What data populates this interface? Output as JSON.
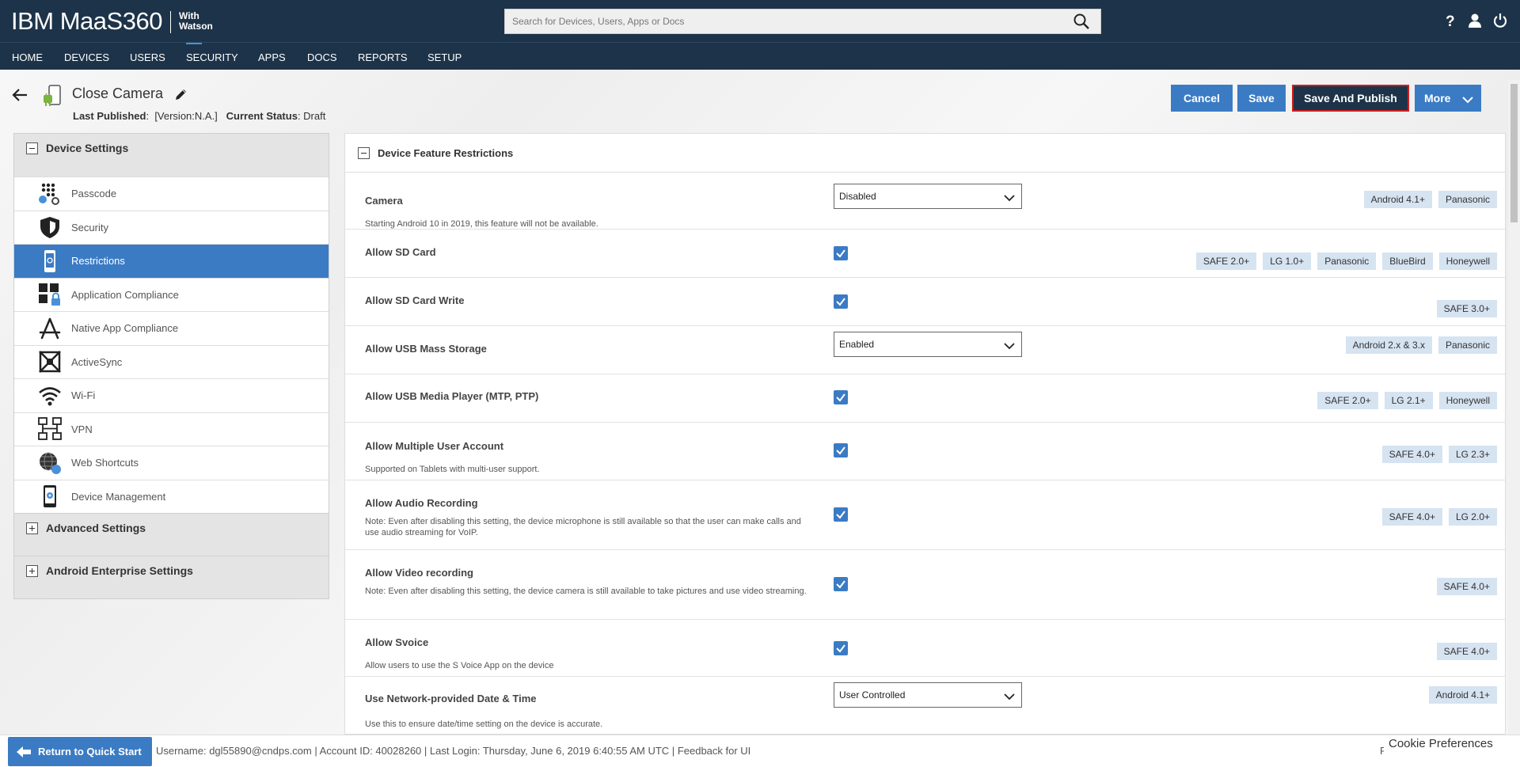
{
  "header": {
    "logo": "IBM MaaS360",
    "logo_with": "With",
    "logo_watson": "Watson",
    "search_placeholder": "Search for Devices, Users, Apps or Docs"
  },
  "nav": [
    "HOME",
    "DEVICES",
    "USERS",
    "SECURITY",
    "APPS",
    "DOCS",
    "REPORTS",
    "SETUP"
  ],
  "nav_active": "SECURITY",
  "page": {
    "title": "Close Camera",
    "last_published_label": "Last Published",
    "last_published_value": "[Version:N.A.]",
    "status_label": "Current Status",
    "status_value": "Draft"
  },
  "actions": {
    "cancel": "Cancel",
    "save": "Save",
    "publish": "Save And Publish",
    "more": "More"
  },
  "sidebar": {
    "group1": "Device Settings",
    "items": [
      {
        "label": "Passcode",
        "icon": "keypad-icon"
      },
      {
        "label": "Security",
        "icon": "shield-icon"
      },
      {
        "label": "Restrictions",
        "icon": "phone-restriction-icon"
      },
      {
        "label": "Application Compliance",
        "icon": "app-lock-icon"
      },
      {
        "label": "Native App Compliance",
        "icon": "app-store-icon"
      },
      {
        "label": "ActiveSync",
        "icon": "sync-icon"
      },
      {
        "label": "Wi-Fi",
        "icon": "wifi-icon"
      },
      {
        "label": "VPN",
        "icon": "network-icon"
      },
      {
        "label": "Web Shortcuts",
        "icon": "globe-icon"
      },
      {
        "label": "Device Management",
        "icon": "device-gear-icon"
      }
    ],
    "group2": "Advanced Settings",
    "group3": "Android Enterprise Settings"
  },
  "main": {
    "section_title": "Device Feature Restrictions",
    "rows": [
      {
        "label": "Camera",
        "control": "select",
        "value": "Disabled",
        "note": "Starting Android 10 in 2019, this feature will not be available.",
        "tags": [
          "Android 4.1+",
          "Panasonic"
        ]
      },
      {
        "label": "Allow SD Card",
        "control": "check",
        "checked": true,
        "note": "",
        "tags": [
          "SAFE 2.0+",
          "LG 1.0+",
          "Panasonic",
          "BlueBird",
          "Honeywell"
        ]
      },
      {
        "label": "Allow SD Card Write",
        "control": "check",
        "checked": true,
        "note": "",
        "tags": [
          "SAFE 3.0+"
        ]
      },
      {
        "label": "Allow USB Mass Storage",
        "control": "select",
        "value": "Enabled",
        "note": "",
        "tags": [
          "Android 2.x & 3.x",
          "Panasonic"
        ]
      },
      {
        "label": "Allow USB Media Player (MTP, PTP)",
        "control": "check",
        "checked": true,
        "note": "",
        "tags": [
          "SAFE 2.0+",
          "LG 2.1+",
          "Honeywell"
        ]
      },
      {
        "label": "Allow Multiple User Account",
        "control": "check",
        "checked": true,
        "note": "Supported on Tablets with multi-user support.",
        "tags": [
          "SAFE 4.0+",
          "LG 2.3+"
        ]
      },
      {
        "label": "Allow Audio Recording",
        "control": "check",
        "checked": true,
        "note": "Note: Even after disabling this setting, the device microphone is still available so that the user can make calls and use audio streaming for VoIP.",
        "tags": [
          "SAFE 4.0+",
          "LG 2.0+"
        ]
      },
      {
        "label": "Allow Video recording",
        "control": "check",
        "checked": true,
        "note": "Note: Even after disabling this setting, the device camera is still available to take pictures and use video streaming.",
        "tags": [
          "SAFE 4.0+"
        ]
      },
      {
        "label": "Allow Svoice",
        "control": "check",
        "checked": true,
        "note": "Allow users to use the S Voice App on the device",
        "tags": [
          "SAFE 4.0+"
        ]
      },
      {
        "label": "Use Network-provided Date & Time",
        "control": "select",
        "value": "User Controlled",
        "note": "Use this to ensure date/time setting on the device is accurate.",
        "tags": [
          "Android 4.1+"
        ]
      }
    ]
  },
  "footer": {
    "quick_start": "Return to Quick Start",
    "info": "Username:  dgl55890@cndps.com  | Account ID:  40028260  | Last Login: Thursday, June 6, 2019 6:40:55 AM UTC   |",
    "feedback": "Feedback for UI",
    "cookie": "Cookie Preferences",
    "trailing_char": "F"
  }
}
